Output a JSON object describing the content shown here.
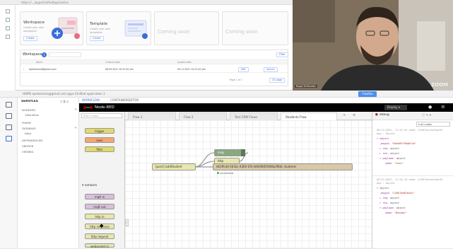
{
  "top_browser": {
    "url": "https://…/apps/UnifiedApplication",
    "cards": [
      {
        "title": "Workspace",
        "subtitle": "Create your own workspace",
        "button": "Create"
      },
      {
        "title": "Template",
        "subtitle": "Create your own templates",
        "button": "Create"
      },
      {
        "title": "Coming soon"
      },
      {
        "title": "Coming soon"
      }
    ],
    "workspaces": {
      "title": "Workspaces",
      "count": "1",
      "filter_label": "Filter",
      "columns": [
        "Name",
        "Created date",
        "Update date"
      ],
      "rows": [
        {
          "name": "apelemenia@gmail.com",
          "created": "08.09.2021 10:47:42 pm",
          "updated": "09.11.2021 12:51:42 pm",
          "action1": "edit",
          "action2": "launch"
        }
      ],
      "pager": "Page 1 of 1",
      "per_page": "10 page"
    }
  },
  "webcam": {
    "name_tag": "Ragel M.Pandev",
    "brand": "ZOOM"
  },
  "bottom": {
    "url": "HOME  apelemenia@gmail.com.apps /Unified application 1",
    "open_button": "Flowfox",
    "services": {
      "title": "SERVICES",
      "items": [
        "NODERED",
        "1Workflow",
        "FRAME",
        "DATABASE",
        "Data",
        "DEPENDENCIES",
        "UBODSR",
        "VIEWBIG"
      ]
    },
    "workspace_tabs": [
      "WORKFLOW",
      "CONTAINEREDITOR"
    ]
  },
  "nodered": {
    "title": "Node-RED",
    "deploy_label": "Deploy",
    "palette": {
      "filter_placeholder": "filter nodes",
      "top_nodes": [
        {
          "label": "trigger",
          "color": "#e2d96e"
        },
        {
          "label": "exec",
          "color": "#f3a670"
        },
        {
          "label": "filter",
          "color": "#e2d96e"
        }
      ],
      "section": "network",
      "nodes": [
        {
          "label": "mqtt in",
          "color": "#d8bfd8"
        },
        {
          "label": "mqtt out",
          "color": "#d8bfd8"
        },
        {
          "label": "http in",
          "color": "#e7e7ae"
        },
        {
          "label": "http response",
          "color": "#e7e7ae"
        },
        {
          "label": "http request",
          "color": "#e7e7ae"
        },
        {
          "label": "websocket in",
          "color": "#e7e7ae"
        },
        {
          "label": "websocket out",
          "color": "#e7e7ae"
        }
      ]
    },
    "tabs": [
      {
        "label": "Flow 1",
        "active": false
      },
      {
        "label": "Flow 2",
        "active": false
      },
      {
        "label": "Test CRM Flows",
        "active": false
      },
      {
        "label": "Students Flow",
        "active": true
      }
    ],
    "flow_nodes": {
      "http_in": "[post] /addStudent",
      "msg": "msg",
      "http": "http",
      "mongo": "db1ffc4d-1632c-4360-1f0-4d03f845fd08a2f8dc",
      "mongo_suffix": "students",
      "status": "connected"
    },
    "sidebar": {
      "tab": "debug",
      "filter": "all nodes",
      "messages": [
        {
          "meta1": "09/11/2021, 11:51:44",
          "meta2": "node: 4fd6f4ac4a7ebe59",
          "topic": "msg : Object",
          "lines": [
            {
              "k": "▾ object",
              "v": ""
            },
            {
              "k": "_msgid:",
              "v": "\"b5ed95f58a6c3a\""
            },
            {
              "k": "▸ req:",
              "v": "object"
            },
            {
              "k": "▸ res:",
              "v": "object"
            },
            {
              "k": "▾ payload:",
              "v": "object"
            },
            {
              "k": "name:",
              "v": "\"test\""
            }
          ]
        },
        {
          "meta1": "09/11/2021, 11:52:10",
          "meta2": "node: 4fd6f4ac4a7ebe59",
          "topic": "msg : Object",
          "lines": [
            {
              "k": "▾ object",
              "v": ""
            },
            {
              "k": "_msgid:",
              "v": "\"126e7eb87b3ac\""
            },
            {
              "k": "▸ req:",
              "v": "object"
            },
            {
              "k": "▸ res:",
              "v": "object"
            },
            {
              "k": "▾ payload:",
              "v": "object"
            },
            {
              "k": "name:",
              "v": "\"Василь\""
            }
          ]
        }
      ]
    }
  },
  "colors": {
    "accent": "#4d8ff0",
    "nodered_header": "#000000",
    "mongo_node": "#d8c8a5",
    "http_node": "#e7e7ae",
    "function_node": "#87a980"
  }
}
